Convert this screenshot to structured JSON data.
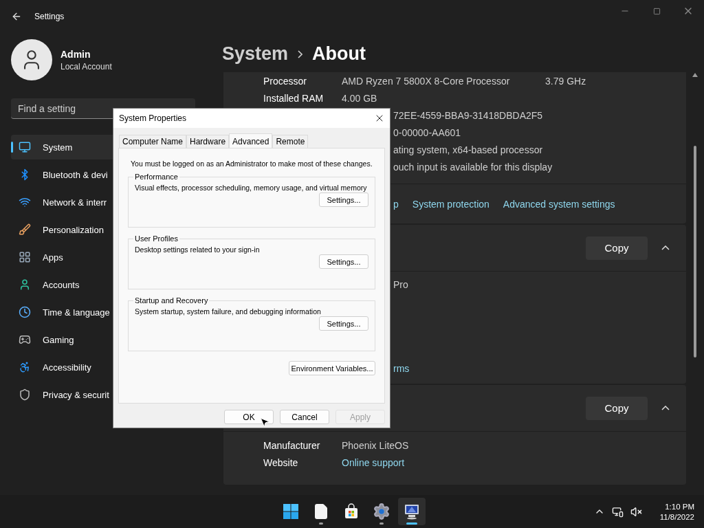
{
  "window": {
    "title": "Settings"
  },
  "account": {
    "name": "Admin",
    "type": "Local Account"
  },
  "search": {
    "placeholder": "Find a setting"
  },
  "nav": [
    {
      "label": "System",
      "selected": true
    },
    {
      "label": "Bluetooth & devi",
      "selected": false
    },
    {
      "label": "Network & interr",
      "selected": false
    },
    {
      "label": "Personalization",
      "selected": false
    },
    {
      "label": "Apps",
      "selected": false
    },
    {
      "label": "Accounts",
      "selected": false
    },
    {
      "label": "Time & language",
      "selected": false
    },
    {
      "label": "Gaming",
      "selected": false
    },
    {
      "label": "Accessibility",
      "selected": false
    },
    {
      "label": "Privacy & securit",
      "selected": false
    }
  ],
  "breadcrumb": {
    "parent": "System",
    "current": "About"
  },
  "device_specs": {
    "rows": [
      {
        "kind": "full",
        "label": "Processor",
        "value": "AMD Ryzen 7 5800X 8-Core Processor",
        "extra": "3.79 GHz"
      },
      {
        "kind": "full",
        "label": "Installed RAM",
        "value": "4.00 GB"
      },
      {
        "kind": "partial",
        "value": "72EE-4559-BBA9-31418DBDA2F5"
      },
      {
        "kind": "partial",
        "value": "0-00000-AA601"
      },
      {
        "kind": "partial",
        "value": "ating system, x64-based processor"
      },
      {
        "kind": "partial",
        "value": "ouch input is available for this display"
      }
    ],
    "links": [
      "p",
      "System protection",
      "Advanced system settings"
    ]
  },
  "windows_specs": {
    "button": "Copy",
    "expanded": true,
    "rows": [
      {
        "kind": "partial",
        "value": "Pro"
      },
      {
        "kind": "partial_link",
        "value": "rms"
      }
    ]
  },
  "support": {
    "button": "Copy",
    "expanded": true,
    "rows": [
      {
        "kind": "full",
        "label": "Manufacturer",
        "value": "Phoenix LiteOS"
      },
      {
        "kind": "full_link",
        "label": "Website",
        "value": "Online support"
      }
    ]
  },
  "dialog": {
    "title": "System Properties",
    "tabs": [
      {
        "label": "Computer Name",
        "selected": false
      },
      {
        "label": "Hardware",
        "selected": false
      },
      {
        "label": "Advanced",
        "selected": true
      },
      {
        "label": "Remote",
        "selected": false
      }
    ],
    "notice": "You must be logged on as an Administrator to make most of these changes.",
    "groups": [
      {
        "title": "Performance",
        "description": "Visual effects, processor scheduling, memory usage, and virtual memory",
        "button": "Settings..."
      },
      {
        "title": "User Profiles",
        "description": "Desktop settings related to your sign-in",
        "button": "Settings..."
      },
      {
        "title": "Startup and Recovery",
        "description": "System startup, system failure, and debugging information",
        "button": "Settings..."
      }
    ],
    "env_button": "Environment Variables...",
    "buttons": [
      {
        "label": "OK",
        "disabled": false
      },
      {
        "label": "Cancel",
        "disabled": false
      },
      {
        "label": "Apply",
        "disabled": true
      }
    ]
  },
  "taskbar": {
    "apps": [
      {
        "kind": "start",
        "running": false,
        "active": false
      },
      {
        "kind": "file",
        "running": true,
        "active": false
      },
      {
        "kind": "store",
        "running": false,
        "active": false
      },
      {
        "kind": "settings",
        "running": true,
        "active": false
      },
      {
        "kind": "system",
        "running": true,
        "active": true
      }
    ],
    "time": "1:10 PM",
    "date": "11/8/2022"
  }
}
